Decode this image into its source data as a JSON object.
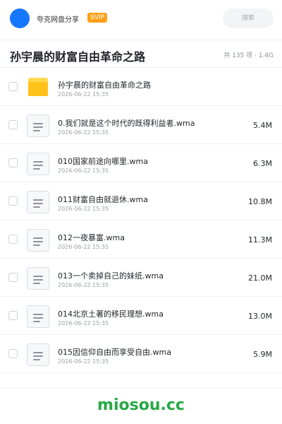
{
  "header": {
    "app_name": "夸克网盘分享",
    "badge": "SVIP",
    "search_placeholder": "搜索"
  },
  "folder": {
    "title": "孙宇晨的财富自由革命之路",
    "summary": "共 135 项 · 1.4G"
  },
  "items": [
    {
      "type": "folder",
      "name": "孙宇晨的财富自由革命之路",
      "date": "2026-06-22 15:35",
      "size": ""
    },
    {
      "type": "file",
      "name": "0.我们就是这个时代的既得利益者.wma",
      "date": "2026-06-22 15:35",
      "size": "5.4M"
    },
    {
      "type": "file",
      "name": "010国家前途向哪里.wma",
      "date": "2026-06-22 15:35",
      "size": "6.3M"
    },
    {
      "type": "file",
      "name": "011财富自由就退休.wma",
      "date": "2026-06-22 15:35",
      "size": "10.8M"
    },
    {
      "type": "file",
      "name": "012一夜暴富.wma",
      "date": "2026-06-22 15:35",
      "size": "11.3M"
    },
    {
      "type": "file",
      "name": "013一个卖掉自己的妹纸.wma",
      "date": "2026-06-22 15:35",
      "size": "21.0M"
    },
    {
      "type": "file",
      "name": "014北京土著的移民理想.wma",
      "date": "2026-06-22 15:35",
      "size": "13.0M"
    },
    {
      "type": "file",
      "name": "015因信仰自由而享受自由.wma",
      "date": "2026-06-22 15:35",
      "size": "5.9M"
    }
  ],
  "watermark": "miosou.cc",
  "colors": {
    "accent": "#1677ff",
    "badge": "#ff9f1a",
    "folder": "#ffc21a",
    "watermark": "#27a845"
  }
}
